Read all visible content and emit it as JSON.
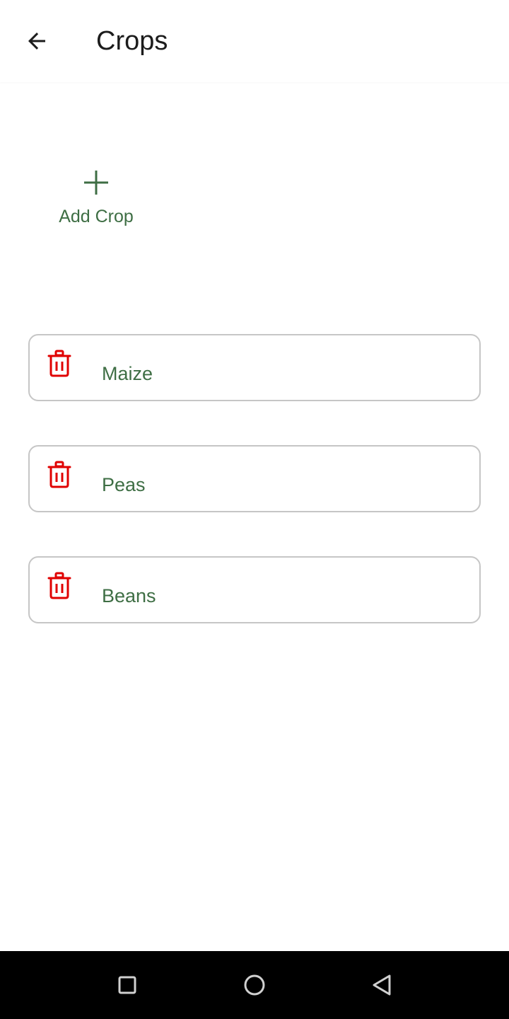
{
  "appbar": {
    "title": "Crops",
    "back_icon": "arrow-left-icon"
  },
  "add_crop": {
    "label": "Add Crop",
    "icon": "plus-icon"
  },
  "crops": [
    {
      "name": "Maize",
      "delete_icon": "trash-icon"
    },
    {
      "name": "Peas",
      "delete_icon": "trash-icon"
    },
    {
      "name": "Beans",
      "delete_icon": "trash-icon"
    }
  ],
  "colors": {
    "accent_green": "#3e6e44",
    "delete_red": "#e00000",
    "border_gray": "#c6c6c6",
    "title_text": "#1c1c1c"
  },
  "navbar": {
    "items": [
      "recents-square-icon",
      "home-circle-icon",
      "back-triangle-icon"
    ]
  }
}
